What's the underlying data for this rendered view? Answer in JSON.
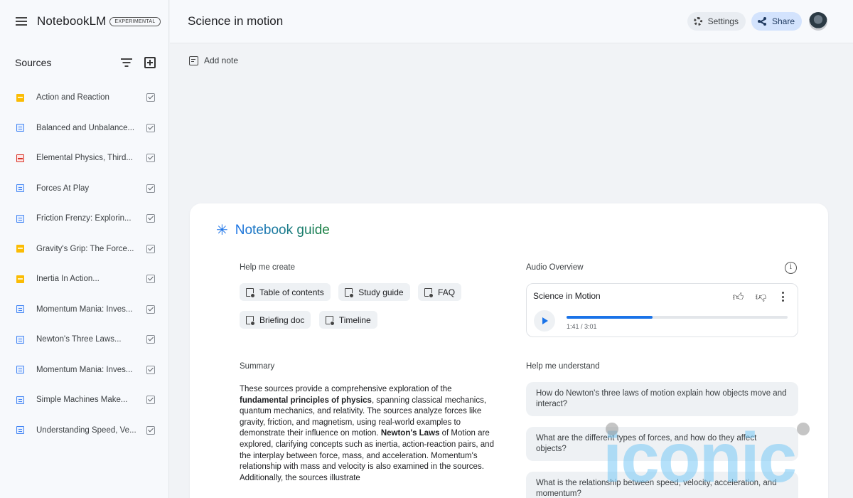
{
  "app": {
    "name": "NotebookLM",
    "badge": "EXPERIMENTAL"
  },
  "sidebar": {
    "sources_title": "Sources",
    "sources": [
      {
        "label": "Action and Reaction",
        "type": "slides",
        "checked": true
      },
      {
        "label": "Balanced and Unbalance...",
        "type": "doc",
        "checked": true
      },
      {
        "label": "Elemental Physics, Third...",
        "type": "pdf",
        "checked": true
      },
      {
        "label": "Forces At Play",
        "type": "doc",
        "checked": true
      },
      {
        "label": "Friction Frenzy: Explorin...",
        "type": "doc",
        "checked": true
      },
      {
        "label": "Gravity's Grip: The Force...",
        "type": "slides",
        "checked": true
      },
      {
        "label": "Inertia In Action...",
        "type": "slides",
        "checked": true
      },
      {
        "label": "Momentum Mania: Inves...",
        "type": "doc",
        "checked": true
      },
      {
        "label": "Newton's Three Laws...",
        "type": "doc",
        "checked": true
      },
      {
        "label": "Momentum Mania: Inves...",
        "type": "doc",
        "checked": true
      },
      {
        "label": "Simple Machines Make...",
        "type": "doc",
        "checked": true
      },
      {
        "label": "Understanding Speed, Ve...",
        "type": "doc",
        "checked": true
      }
    ]
  },
  "header": {
    "notebook_title": "Science in motion",
    "settings_label": "Settings",
    "share_label": "Share"
  },
  "notes": {
    "add_note_label": "Add note"
  },
  "guide": {
    "title": "Notebook guide",
    "help_create_label": "Help me create",
    "chips": [
      "Table of contents",
      "Study guide",
      "FAQ",
      "Briefing doc",
      "Timeline"
    ],
    "audio": {
      "label": "Audio Overview",
      "title": "Science in Motion",
      "time": "1:41 / 3:01",
      "progress": 0.39
    },
    "summary_label": "Summary",
    "summary": {
      "p1": "These sources provide a comprehensive exploration of the ",
      "b1": "fundamental principles of physics",
      "p2": ", spanning classical mechanics, quantum mechanics, and relativity. The sources analyze forces like gravity, friction, and magnetism, using real-world examples to demonstrate their influence on motion. ",
      "b2": "Newton's Laws",
      "p3": " of Motion are explored, clarifying concepts such as inertia, action-reaction pairs, and the interplay between force, mass, and acceleration. Momentum's relationship with mass and velocity is also examined in the sources. Additionally, the sources illustrate"
    },
    "understand_label": "Help me understand",
    "questions": [
      "How do Newton's three laws of motion explain how objects move and interact?",
      "What are the different types of forces, and how do they affect objects?",
      "What is the relationship between speed, velocity, acceleration, and momentum?"
    ]
  },
  "watermark": {
    "text": "iconic"
  },
  "colors": {
    "accent": "#1a73e8",
    "share_bg": "#d3e3fd",
    "guide_green": "#188038"
  }
}
